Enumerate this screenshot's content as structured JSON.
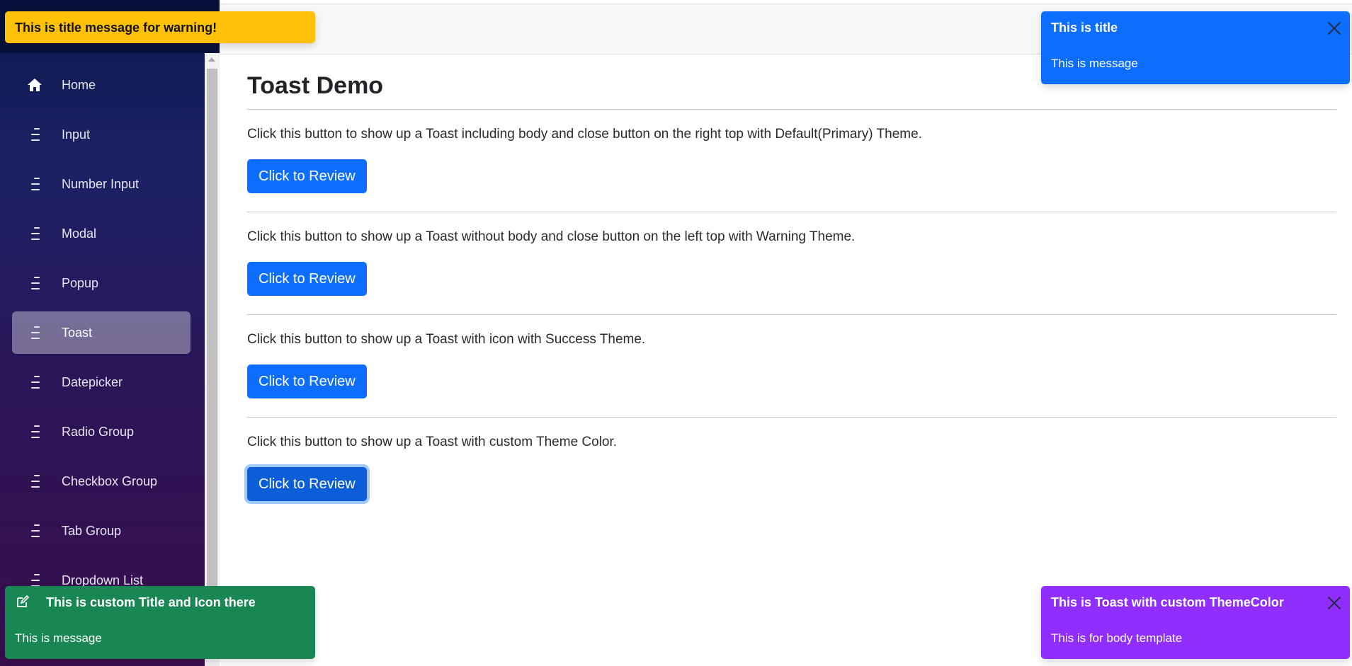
{
  "sidebar": {
    "items": [
      {
        "label": "Home",
        "icon": "home-icon",
        "active": false
      },
      {
        "label": "Input",
        "icon": "menu-icon",
        "active": false
      },
      {
        "label": "Number Input",
        "icon": "menu-icon",
        "active": false
      },
      {
        "label": "Modal",
        "icon": "menu-icon",
        "active": false
      },
      {
        "label": "Popup",
        "icon": "menu-icon",
        "active": false
      },
      {
        "label": "Toast",
        "icon": "menu-icon",
        "active": true
      },
      {
        "label": "Datepicker",
        "icon": "menu-icon",
        "active": false
      },
      {
        "label": "Radio Group",
        "icon": "menu-icon",
        "active": false
      },
      {
        "label": "Checkbox Group",
        "icon": "menu-icon",
        "active": false
      },
      {
        "label": "Tab Group",
        "icon": "menu-icon",
        "active": false
      },
      {
        "label": "Dropdown List",
        "icon": "menu-icon",
        "active": false
      }
    ]
  },
  "main": {
    "title": "Toast Demo",
    "sections": [
      {
        "text": "Click this button to show up a Toast including body and close button on the right top with Default(Primary) Theme.",
        "button": "Click to Review"
      },
      {
        "text": "Click this button to show up a Toast without body and close button on the left top with Warning Theme.",
        "button": "Click to Review"
      },
      {
        "text": "Click this button to show up a Toast with icon with Success Theme.",
        "button": "Click to Review"
      },
      {
        "text": "Click this button to show up a Toast with custom Theme Color.",
        "button": "Click to Review"
      }
    ]
  },
  "toasts": {
    "warning": {
      "title": "This is title message for warning!",
      "color": "#ffc107"
    },
    "primary": {
      "title": "This is title",
      "message": "This is message",
      "color": "#0d6efd"
    },
    "success": {
      "title": "This is custom Title and Icon there",
      "message": "This is message",
      "icon": "edit-icon",
      "color": "#198754"
    },
    "custom": {
      "title": "This is Toast with custom ThemeColor",
      "message": "This is for body template",
      "color": "#8f2eff"
    }
  },
  "colors": {
    "accent": "#0d6efd",
    "sidebar_active": "rgba(255,255,255,0.37)"
  }
}
